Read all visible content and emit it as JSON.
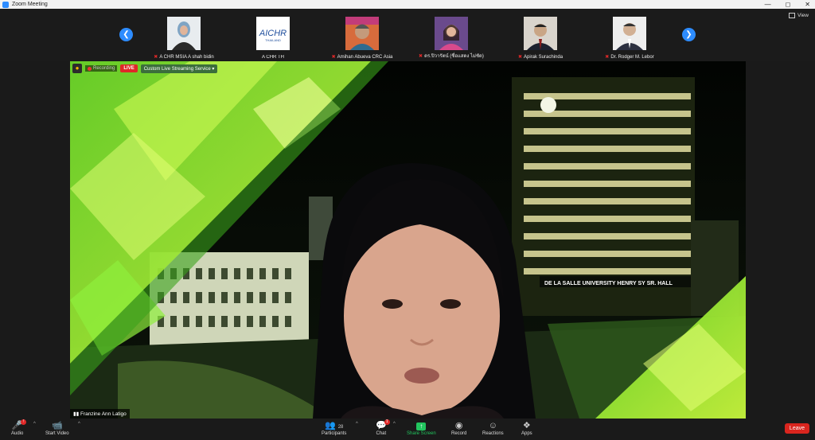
{
  "window": {
    "title": "Zoom Meeting",
    "controls": [
      "—",
      "◻",
      "✕"
    ]
  },
  "gallery": {
    "view_label": "View",
    "tiles": [
      {
        "name": "A CHR MSIA A shah bidin",
        "muted": true,
        "logo": false
      },
      {
        "name": "A CHR TH",
        "muted": false,
        "logo": true,
        "logo_text": "AICHR",
        "logo_sub": "THAILAND"
      },
      {
        "name": "Amihan Abueva CRC Asia",
        "muted": true,
        "logo": false
      },
      {
        "name": "ดร.ปิวารัตน์ (ชื่อแสดง ไม่ชัด)",
        "muted": true,
        "logo": false
      },
      {
        "name": "Apirak Surachinda",
        "muted": true,
        "logo": false
      },
      {
        "name": "Dr. Rodger M. Lebor",
        "muted": true,
        "logo": false
      }
    ]
  },
  "main_video": {
    "recording_label": "Recording",
    "live_label": "LIVE",
    "stream_label": "Custom Live Streaming Service",
    "speaker_name": "Franzine Ann Latigo",
    "building_sign": "DE LA SALLE UNIVERSITY HENRY SY SR. HALL"
  },
  "toolbar": {
    "audio": "Audio",
    "video": "Start Video",
    "participants": "Participants",
    "participants_count": "28",
    "chat": "Chat",
    "chat_badge": "1",
    "share": "Share Screen",
    "record": "Record",
    "reactions": "Reactions",
    "apps": "Apps",
    "leave": "Leave"
  },
  "colors": {
    "accent": "#2d8cff",
    "leave": "#d9251e",
    "share": "#22c55e",
    "live": "#e02828"
  }
}
